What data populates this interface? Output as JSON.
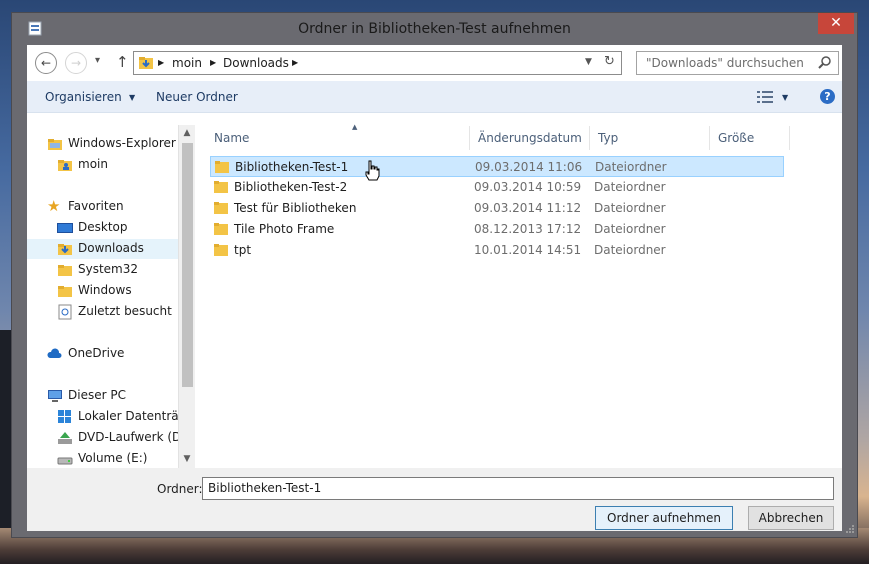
{
  "window": {
    "title": "Ordner in Bibliotheken-Test aufnehmen",
    "close_label": "✕"
  },
  "nav": {
    "breadcrumb": [
      "moin",
      "Downloads"
    ],
    "search_placeholder": "\"Downloads\" durchsuchen"
  },
  "toolbar": {
    "organize_label": "Organisieren",
    "new_folder_label": "Neuer Ordner"
  },
  "sidebar": {
    "items": [
      {
        "label": "Windows-Explorer",
        "icon": "folder-icon"
      },
      {
        "label": "moin",
        "icon": "user-folder-icon"
      },
      {
        "label": "Favoriten",
        "icon": "star-icon"
      },
      {
        "label": "Desktop",
        "icon": "desktop-icon"
      },
      {
        "label": "Downloads",
        "icon": "downloads-icon"
      },
      {
        "label": "System32",
        "icon": "folder-icon"
      },
      {
        "label": "Windows",
        "icon": "folder-icon"
      },
      {
        "label": "Zuletzt besucht",
        "icon": "recent-icon"
      },
      {
        "label": "OneDrive",
        "icon": "cloud-icon"
      },
      {
        "label": "Dieser PC",
        "icon": "computer-icon"
      },
      {
        "label": "Lokaler Datenträger",
        "icon": "drive-icon"
      },
      {
        "label": "DVD-Laufwerk (D",
        "icon": "dvd-icon"
      },
      {
        "label": "Volume (E:)",
        "icon": "drive-icon"
      }
    ],
    "selected": "Downloads"
  },
  "columns": [
    "Name",
    "Änderungsdatum",
    "Typ",
    "Größe"
  ],
  "files": [
    {
      "name": "Bibliotheken-Test-1",
      "date": "09.03.2014 11:06",
      "type": "Dateiordner"
    },
    {
      "name": "Bibliotheken-Test-2",
      "date": "09.03.2014 10:59",
      "type": "Dateiordner"
    },
    {
      "name": "Test für Bibliotheken",
      "date": "09.03.2014 11:12",
      "type": "Dateiordner"
    },
    {
      "name": "Tile Photo Frame",
      "date": "08.12.2013 17:12",
      "type": "Dateiordner"
    },
    {
      "name": "tpt",
      "date": "10.01.2014 14:51",
      "type": "Dateiordner"
    }
  ],
  "selected_file": "Bibliotheken-Test-1",
  "footer": {
    "folder_label": "Ordner:",
    "folder_value": "Bibliotheken-Test-1",
    "add_button": "Ordner aufnehmen",
    "cancel_button": "Abbrechen"
  },
  "colors": {
    "title_bar": "#6a6a70",
    "close_button": "#c7463a",
    "toolbar_bg": "#e7eef8",
    "selection": "#cce8ff",
    "folder_yellow": "#f3c446"
  }
}
